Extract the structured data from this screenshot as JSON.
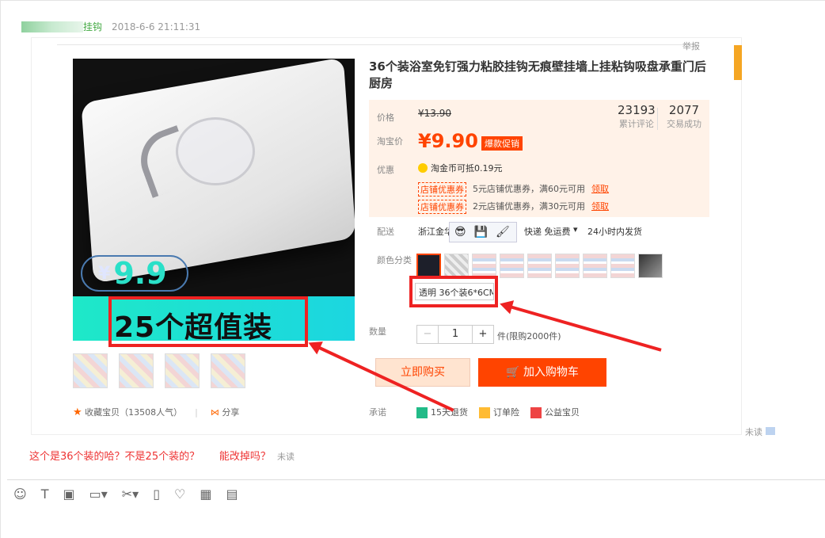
{
  "message": {
    "sender_suffix": "挂钩",
    "timestamp": "2018-6-6 21:11:31"
  },
  "product": {
    "report": "举报",
    "title": "36个装浴室免钉强力粘胶挂钩无痕壁挂墙上挂粘钩吸盘承重门后厨房",
    "image_price_currency": "¥",
    "image_price": "9.9",
    "image_banner": "25个超值装",
    "favorite": "收藏宝贝（13508人气）",
    "share": "分享",
    "labels": {
      "price": "价格",
      "taobao_price": "淘宝价",
      "discount": "优惠",
      "delivery": "配送",
      "color": "颜色分类",
      "quantity": "数量",
      "promise": "承诺"
    },
    "old_price": "¥13.90",
    "taobao_price": "¥9.90",
    "promo_tag": "爆款促销",
    "stats": [
      {
        "num": "23193",
        "label": "累计评论"
      },
      {
        "num": "2077",
        "label": "交易成功"
      }
    ],
    "coin_text": "淘金币可抵0.19元",
    "coupons": [
      {
        "tag": "店铺优惠券",
        "text": "5元店铺优惠券，满60元可用",
        "get": "领取"
      },
      {
        "tag": "店铺优惠券",
        "text": "2元店铺优惠券，满30元可用",
        "get": "领取"
      }
    ],
    "ship_from": "浙江金华",
    "ship_method": "快递 免运费",
    "ship_time": "24小时内发货",
    "color_tooltip": "透明 36个装6*6CM",
    "qty_value": "1",
    "qty_note": "件(限购2000件)",
    "buy_now": "立即购买",
    "add_cart": "加入购物车",
    "promises": [
      "15天退货",
      "订单险",
      "公益宝贝"
    ]
  },
  "side_unread": "未读",
  "reply": {
    "text": "这个是36个装的哈？不是25个装的？      能改掉吗？",
    "status": "未读"
  },
  "toolbar_icons": [
    "emoji-icon",
    "text-icon",
    "image-icon",
    "folder-icon",
    "scissors-icon",
    "shake-icon",
    "heart-icon",
    "calculator-icon",
    "receipt-icon"
  ]
}
